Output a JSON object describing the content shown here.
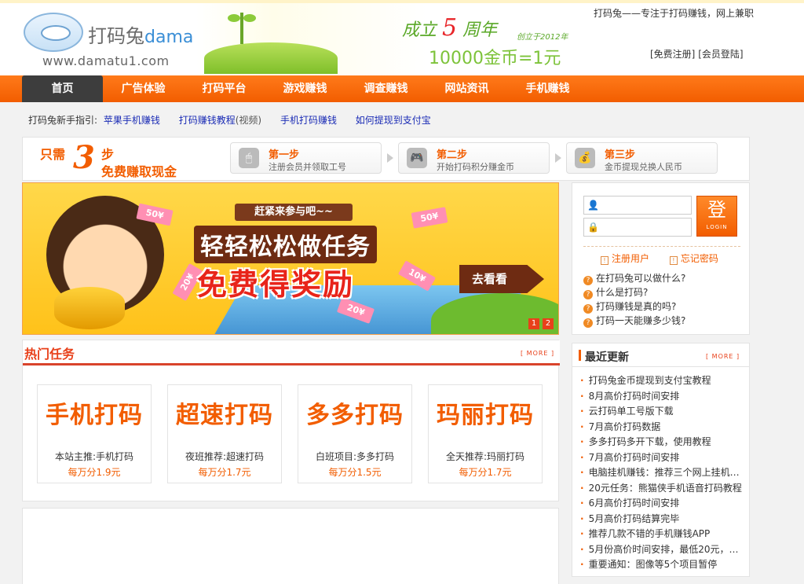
{
  "header": {
    "logo_name": "打码兔",
    "logo_sub": "dama",
    "logo_url": "www.damatu1.com",
    "banner_anniv_a": "成立",
    "banner_anniv_num": "5",
    "banner_anniv_b": "周年",
    "banner_since": "创立于2012年",
    "banner_gold": "10000金币=1元",
    "slogan": "打码兔——专注于打码赚钱，网上兼职",
    "register_link": "[免费注册]",
    "login_link": "[会员登陆]"
  },
  "nav": {
    "items": [
      {
        "label": "首页"
      },
      {
        "label": "广告体验"
      },
      {
        "label": "打码平台"
      },
      {
        "label": "游戏赚钱"
      },
      {
        "label": "调查赚钱"
      },
      {
        "label": "网站资讯"
      },
      {
        "label": "手机赚钱"
      }
    ]
  },
  "guide": {
    "label": "打码兔新手指引:",
    "links": [
      "苹果手机赚钱",
      "打码赚钱教程",
      "手机打码赚钱",
      "如何提现到支付宝"
    ],
    "video_note": "(视频)"
  },
  "steps": {
    "prefix": "只需",
    "number": "3",
    "suffix": "步",
    "tagline": "免费赚取现金",
    "items": [
      {
        "title": "第一步",
        "desc": "注册会员并领取工号",
        "icon": "🖱"
      },
      {
        "title": "第二步",
        "desc": "开始打码积分赚金币",
        "icon": "🎮"
      },
      {
        "title": "第三步",
        "desc": "金币提现兑换人民币",
        "icon": "💰"
      }
    ]
  },
  "hero": {
    "sign": "赶紧来参与吧~~",
    "title1": "轻轻松松做任务",
    "title2": "免费得奖励",
    "go": "去看看",
    "bills": [
      "50¥",
      "50¥",
      "20¥",
      "10¥",
      "20¥"
    ],
    "pages": [
      "1",
      "2"
    ]
  },
  "login": {
    "username_placeholder": "",
    "password_placeholder": "",
    "button_big": "登",
    "button_small": "LOGIN",
    "register": "注册用户",
    "forgot": "忘记密码",
    "faq": [
      "在打码兔可以做什么?",
      "什么是打码?",
      "打码赚钱是真的吗?",
      "打码一天能赚多少钱?"
    ]
  },
  "hot": {
    "title": "热门任务",
    "more": "[ MORE ]",
    "cards": [
      {
        "logo": "手机打码",
        "label": "本站主推:手机打码",
        "price": "每万分1.9元"
      },
      {
        "logo": "超速打码",
        "label": "夜班推荐:超速打码",
        "price": "每万分1.7元"
      },
      {
        "logo": "多多打码",
        "label": "白班项目:多多打码",
        "price": "每万分1.5元"
      },
      {
        "logo": "玛丽打码",
        "label": "全天推荐:玛丽打码",
        "price": "每万分1.7元"
      }
    ]
  },
  "latest": {
    "title": "最近更新",
    "more": "[ MORE ]",
    "items": [
      "打码兔金币提现到支付宝教程",
      "8月高价打码时间安排",
      "云打码单工号版下载",
      "7月高价打码数据",
      "多多打码多开下载，使用教程",
      "7月高价打码时间安排",
      "电脑挂机赚钱：推荐三个网上挂机…",
      "20元任务：熊猫侠手机语音打码教程",
      "6月高价打码时间安排",
      "5月高价打码结算完毕",
      "推荐几款不错的手机赚钱APP",
      "5月份高价时间安排，最低20元，…",
      "重要通知：图像等5个项目暂停"
    ]
  },
  "colors": {
    "brand_orange": "#f25d00",
    "nav_active": "#3d3d3d",
    "link_blue": "#1a2bb5"
  }
}
